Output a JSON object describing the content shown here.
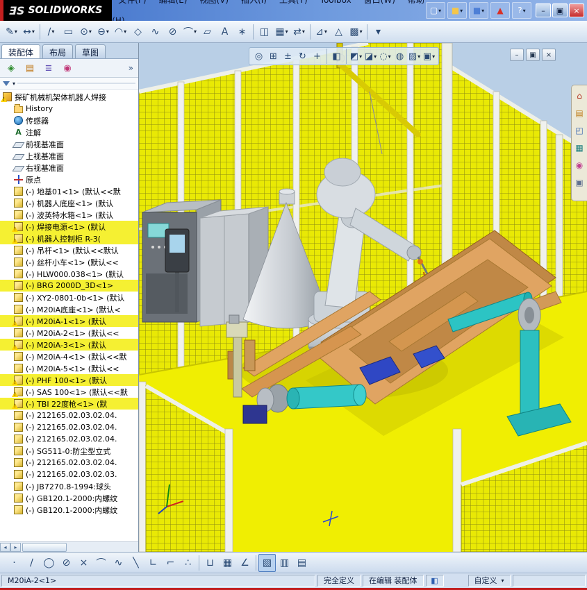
{
  "titlebar": {
    "logo": {
      "prefix": "ƎS",
      "name": "SOLIDWORKS"
    },
    "menus": [
      {
        "name": "file",
        "label": "文件(F)"
      },
      {
        "name": "edit",
        "label": "编辑(E)"
      },
      {
        "name": "view",
        "label": "视图(V)"
      },
      {
        "name": "insert",
        "label": "插入(I)"
      },
      {
        "name": "tools",
        "label": "工具(T)"
      },
      {
        "name": "toolbox",
        "label": "Toolbox"
      },
      {
        "name": "window",
        "label": "窗口(W)"
      },
      {
        "name": "help",
        "label": "帮助(H)"
      }
    ],
    "quick_icons": [
      {
        "name": "new-document",
        "glyph": "▢",
        "color": "#ffffff",
        "dd": true
      },
      {
        "name": "open-document",
        "glyph": "■",
        "color": "#f4c64a",
        "dd": true
      },
      {
        "name": "save-document",
        "glyph": "■",
        "color": "#4d7fd6",
        "dd": true
      },
      {
        "name": "toolbox-browser",
        "glyph": "▲",
        "color": "#d93025",
        "dd": false
      },
      {
        "name": "help",
        "glyph": "?",
        "color": "#ffffff",
        "dd": true
      }
    ],
    "window_buttons": [
      {
        "name": "minimize",
        "glyph": "–"
      },
      {
        "name": "restore",
        "glyph": "▣"
      },
      {
        "name": "close",
        "glyph": "×"
      }
    ]
  },
  "main_toolbar": {
    "items": [
      {
        "name": "sketch",
        "glyph": "✎",
        "dd": true
      },
      {
        "name": "smart-dimension",
        "glyph": "↔",
        "dd": true
      },
      {
        "sep": true
      },
      {
        "name": "line",
        "glyph": "∕",
        "dd": true
      },
      {
        "name": "rectangle",
        "glyph": "▭"
      },
      {
        "name": "circle",
        "glyph": "⊙",
        "dd": true
      },
      {
        "name": "slot",
        "glyph": "⊖",
        "dd": true
      },
      {
        "name": "arc",
        "glyph": "◠",
        "dd": true
      },
      {
        "name": "polygon",
        "glyph": "◇"
      },
      {
        "name": "spline",
        "glyph": "∿"
      },
      {
        "name": "ellipse",
        "glyph": "⊘"
      },
      {
        "name": "fillet",
        "glyph": "⌒",
        "dd": true
      },
      {
        "name": "plane",
        "glyph": "▱"
      },
      {
        "name": "text",
        "glyph": "A"
      },
      {
        "name": "point",
        "glyph": "∗"
      },
      {
        "sep": true
      },
      {
        "name": "mirror-entities",
        "glyph": "◫"
      },
      {
        "name": "linear-sketch-pattern",
        "glyph": "▦",
        "dd": true
      },
      {
        "name": "move-entities",
        "glyph": "⇄",
        "dd": true
      },
      {
        "sep": true
      },
      {
        "name": "display-delete-relations",
        "glyph": "⊿",
        "dd": true
      },
      {
        "name": "repair-sketch",
        "glyph": "△"
      },
      {
        "name": "quick-snaps",
        "glyph": "▩",
        "dd": true
      },
      {
        "sep": true
      },
      {
        "name": "options",
        "glyph": "▾"
      }
    ]
  },
  "left_panel": {
    "tabs": [
      {
        "name": "assembly",
        "label": "装配体",
        "active": true
      },
      {
        "name": "layout",
        "label": "布局",
        "active": false
      },
      {
        "name": "sketch",
        "label": "草图",
        "active": false
      }
    ],
    "manager_icons": [
      {
        "name": "feature-manager",
        "glyph": "◈",
        "color": "#2a8a2a"
      },
      {
        "name": "property-manager",
        "glyph": "▤",
        "color": "#c07818"
      },
      {
        "name": "configuration-manager",
        "glyph": "≣",
        "color": "#6858b8"
      },
      {
        "name": "display-manager",
        "glyph": "◉",
        "color": "#c03878"
      }
    ],
    "overflow": "»",
    "tree": [
      {
        "icon": "assembly",
        "label": "探矿机械机架体机器人焊接",
        "warn": true,
        "top": true
      },
      {
        "icon": "folder",
        "label": "History"
      },
      {
        "icon": "sensor",
        "label": "传感器"
      },
      {
        "icon": "note",
        "label": "注解"
      },
      {
        "icon": "plane",
        "label": "前视基准面"
      },
      {
        "icon": "plane",
        "label": "上视基准面"
      },
      {
        "icon": "plane",
        "label": "右视基准面"
      },
      {
        "icon": "origin",
        "label": "原点"
      },
      {
        "icon": "part",
        "label": "(-) 地基01<1> (默认<<默"
      },
      {
        "icon": "part",
        "label": "(-) 机器人底座<1> (默认"
      },
      {
        "icon": "part",
        "label": "(-) 波英特水箱<1> (默认"
      },
      {
        "icon": "part",
        "label": "(-) 焊接电源<1> (默认",
        "warn": true,
        "hl": true
      },
      {
        "icon": "part",
        "label": "(-) 机器人控制柜 R-3(",
        "warn": true,
        "hl": true
      },
      {
        "icon": "part",
        "label": "(-) 吊杆<1> (默认<<默认"
      },
      {
        "icon": "part",
        "label": "(-) 丝杆小车<1> (默认<<"
      },
      {
        "icon": "part",
        "label": "(-) HLW000.038<1> (默认"
      },
      {
        "icon": "part",
        "label": "(-) BRG 2000D_3D<1>",
        "hl": true
      },
      {
        "icon": "part",
        "label": "(-) XY2-0801-0b<1> (默认"
      },
      {
        "icon": "part",
        "label": "(-) M20iA底座<1> (默认<"
      },
      {
        "icon": "part",
        "label": "(-) M20iA-1<1> (默认",
        "warn": true,
        "hl": true
      },
      {
        "icon": "part",
        "label": "(-) M20iA-2<1> (默认<<"
      },
      {
        "icon": "part",
        "label": "(-) M20iA-3<1> (默认",
        "warn": true,
        "hl": true
      },
      {
        "icon": "part",
        "label": "(-) M20iA-4<1> (默认<<默"
      },
      {
        "icon": "part",
        "label": "(-) M20iA-5<1> (默认<<"
      },
      {
        "icon": "part",
        "label": "(-) PHF 100<1> (默认",
        "warn": true,
        "hl": true
      },
      {
        "icon": "part",
        "label": "(-) SAS 100<1> (默认<<默",
        "warn": true
      },
      {
        "icon": "part",
        "label": "(-) TBI 22度枪<1> (默",
        "warn": true,
        "hl": true
      },
      {
        "icon": "part",
        "label": "(-) 212165.02.03.02.04."
      },
      {
        "icon": "part",
        "label": "(-) 212165.02.03.02.04."
      },
      {
        "icon": "part",
        "label": "(-) 212165.02.03.02.04."
      },
      {
        "icon": "part",
        "label": "(-) SG511-0:防尘型立式"
      },
      {
        "icon": "part",
        "label": "(-) 212165.02.03.02.04."
      },
      {
        "icon": "part",
        "label": "(-) 212165.02.03.02.03."
      },
      {
        "icon": "part",
        "label": "(-) JB7270.8-1994:球头"
      },
      {
        "icon": "part",
        "label": "(-) GB120.1-2000:内螺纹"
      },
      {
        "icon": "part",
        "label": "(-) GB120.1-2000:内螺纹"
      }
    ]
  },
  "viewport": {
    "heads_up_toolbar": [
      {
        "name": "zoom-fit",
        "glyph": "◎"
      },
      {
        "name": "zoom-area",
        "glyph": "⊞"
      },
      {
        "name": "zoom-in-out",
        "glyph": "±"
      },
      {
        "name": "rotate-view",
        "glyph": "↻"
      },
      {
        "name": "pan",
        "glyph": "+"
      },
      {
        "sep": true
      },
      {
        "name": "section-view",
        "glyph": "◧"
      },
      {
        "sep": true
      },
      {
        "name": "view-orientation",
        "glyph": "◩",
        "dd": true
      },
      {
        "name": "display-style",
        "glyph": "◪",
        "dd": true
      },
      {
        "name": "hide-show-items",
        "glyph": "◌",
        "dd": true
      },
      {
        "name": "edit-appearance",
        "glyph": "◍"
      },
      {
        "name": "apply-scene",
        "glyph": "▨",
        "dd": true
      },
      {
        "name": "view-settings",
        "glyph": "▣",
        "dd": true
      }
    ],
    "doc_window_buttons": [
      {
        "name": "doc-minimize",
        "glyph": "–"
      },
      {
        "name": "doc-restore",
        "glyph": "▣"
      },
      {
        "name": "doc-close",
        "glyph": "×"
      }
    ],
    "task_pane_icons": [
      {
        "name": "solidworks-resources",
        "glyph": "⌂",
        "color": "#b03020"
      },
      {
        "name": "design-library",
        "glyph": "▤",
        "color": "#c08020"
      },
      {
        "name": "file-explorer",
        "glyph": "◰",
        "color": "#3060b0"
      },
      {
        "name": "view-palette",
        "glyph": "▦",
        "color": "#208080"
      },
      {
        "name": "appearances-scenes",
        "glyph": "◉",
        "color": "#c04090"
      },
      {
        "name": "custom-properties",
        "glyph": "▣",
        "color": "#607090"
      }
    ],
    "scene_colors": {
      "background": "#b9cfe6",
      "floor": "#f0ee02",
      "fence_mesh": "#e9e905",
      "fence_posts": "#f0f1ee",
      "workpiece_frame": "#e0a462",
      "robot": "#d8dde2",
      "positioner": "#2cc0c0",
      "crane": "#d8ca04",
      "cabinet_dark": "#6b7178",
      "cabinet_light": "#c6cbd0"
    }
  },
  "bottom_toolbar": {
    "items": [
      {
        "name": "sketch-point",
        "glyph": "·"
      },
      {
        "name": "sketch-line",
        "glyph": "∕"
      },
      {
        "name": "sketch-circle",
        "glyph": "◯"
      },
      {
        "name": "sketch-ellipse",
        "glyph": "⊘"
      },
      {
        "name": "sketch-erase",
        "glyph": "×"
      },
      {
        "name": "sketch-arc",
        "glyph": "⌒"
      },
      {
        "name": "sketch-spline",
        "glyph": "∿"
      },
      {
        "name": "sketch-mirror",
        "glyph": "╲"
      },
      {
        "name": "sketch-perpendicular",
        "glyph": "∟"
      },
      {
        "name": "sketch-corner",
        "glyph": "⌐"
      },
      {
        "name": "snap-points",
        "glyph": "∴"
      },
      {
        "sep": true
      },
      {
        "name": "weld-bead",
        "glyph": "⊔"
      },
      {
        "name": "grid-settings",
        "glyph": "▦"
      },
      {
        "name": "measure-angle",
        "glyph": "∠"
      },
      {
        "sep": true
      },
      {
        "name": "shaded-view",
        "glyph": "▧",
        "selected": true
      },
      {
        "name": "split-horizontal",
        "glyph": "▥"
      },
      {
        "name": "split-vertical",
        "glyph": "▤"
      }
    ]
  },
  "statusbar": {
    "selected_item": "M20iA-2<1>",
    "definition_state": "完全定义",
    "edit_mode": "在编辑 装配体",
    "toolbar_preset": "自定义"
  }
}
